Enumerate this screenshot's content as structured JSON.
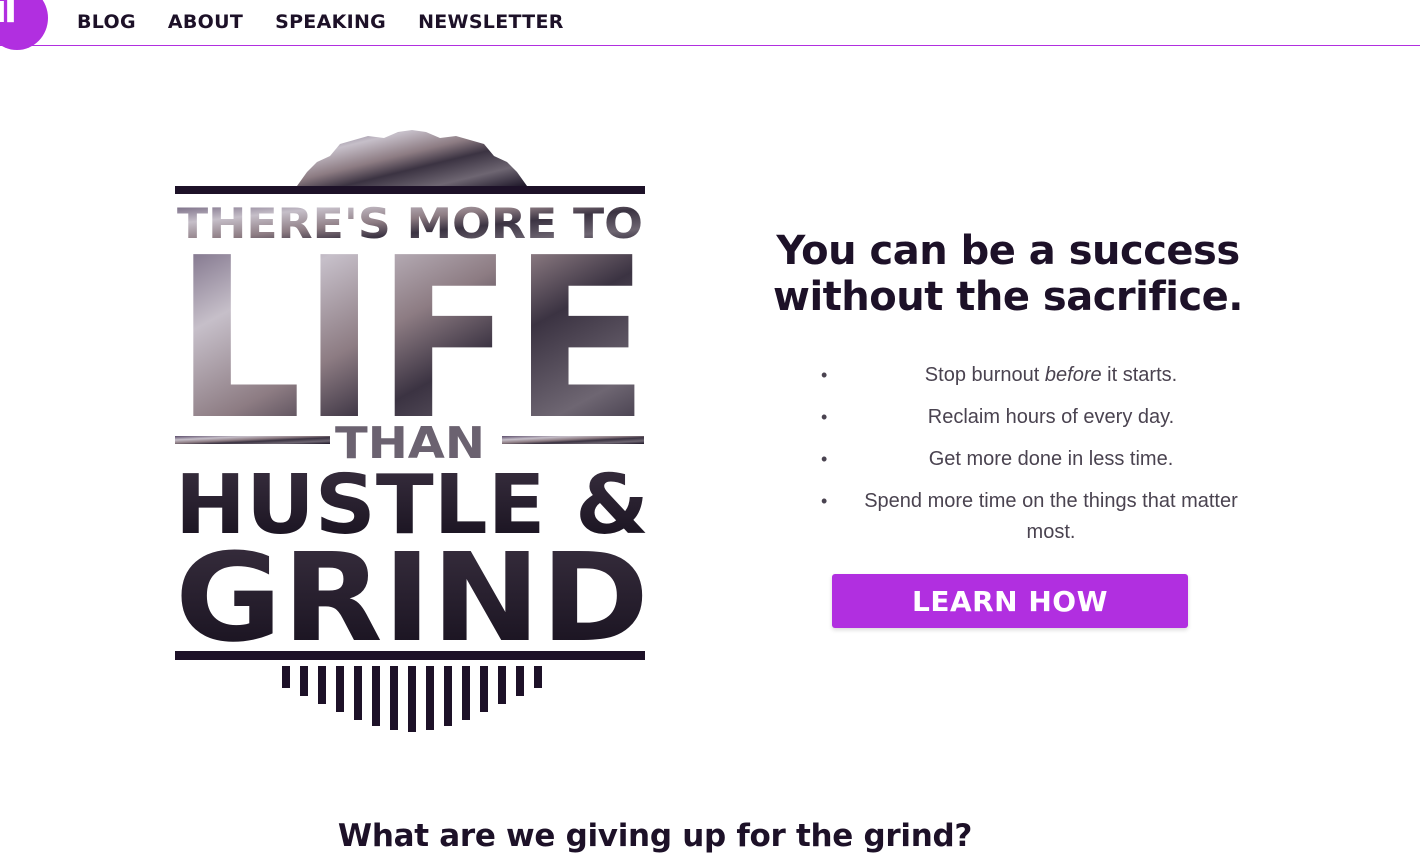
{
  "header": {
    "logo_text": "il",
    "nav": [
      {
        "label": "BLOG"
      },
      {
        "label": "ABOUT"
      },
      {
        "label": "SPEAKING"
      },
      {
        "label": "NEWSLETTER"
      }
    ]
  },
  "poster": {
    "line1": "THERE'S MORE TO",
    "line2": "LIFE",
    "line3": "THAN",
    "line4": "HUSTLE &",
    "line5": "GRIND"
  },
  "hero": {
    "headline_line1": "You can be a success",
    "headline_line2": "without the sacrifice.",
    "bullets": {
      "b1_pre": "Stop burnout ",
      "b1_em": "before",
      "b1_post": " it starts.",
      "b2": "Reclaim hours of every day.",
      "b3": "Get more done in less time.",
      "b4": "Spend more time on the things that matter most."
    },
    "cta_label": "LEARN HOW"
  },
  "section": {
    "title": "What are we giving up for the grind?"
  },
  "colors": {
    "accent": "#b12fe0",
    "ink": "#1d1128",
    "body_text": "#4a4350"
  }
}
